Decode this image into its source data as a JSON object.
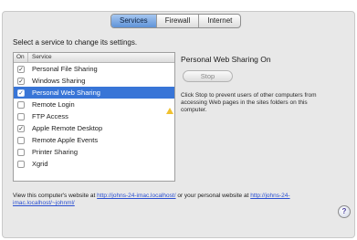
{
  "tabs": [
    {
      "label": "Services",
      "active": true
    },
    {
      "label": "Firewall",
      "active": false
    },
    {
      "label": "Internet",
      "active": false
    }
  ],
  "instruction": "Select a service to change its settings.",
  "table": {
    "headers": {
      "on": "On",
      "service": "Service"
    },
    "rows": [
      {
        "name": "Personal File Sharing",
        "on": true,
        "selected": false
      },
      {
        "name": "Windows Sharing",
        "on": true,
        "selected": false
      },
      {
        "name": "Personal Web Sharing",
        "on": true,
        "selected": true
      },
      {
        "name": "Remote Login",
        "on": false,
        "selected": false
      },
      {
        "name": "FTP Access",
        "on": false,
        "selected": false
      },
      {
        "name": "Apple Remote Desktop",
        "on": true,
        "selected": false
      },
      {
        "name": "Remote Apple Events",
        "on": false,
        "selected": false
      },
      {
        "name": "Printer Sharing",
        "on": false,
        "selected": false
      },
      {
        "name": "Xgrid",
        "on": false,
        "selected": false
      }
    ]
  },
  "status": {
    "title": "Personal Web Sharing On",
    "stop_label": "Stop",
    "description": "Click Stop to prevent users of other computers from accessing Web pages in the sites folders on this computer."
  },
  "footer": {
    "text_before": "View this computer's website at ",
    "link1": "http://johns-24-imac.localhost/",
    "text_mid": " or your personal website at ",
    "link2": "http://johns-24-imac.localhost/~johnml/"
  },
  "help_label": "?",
  "colors": {
    "selection": "#3875d7",
    "tab_active": "#5f93d8",
    "link": "#2a4fd1",
    "warning": "#f0c130"
  }
}
